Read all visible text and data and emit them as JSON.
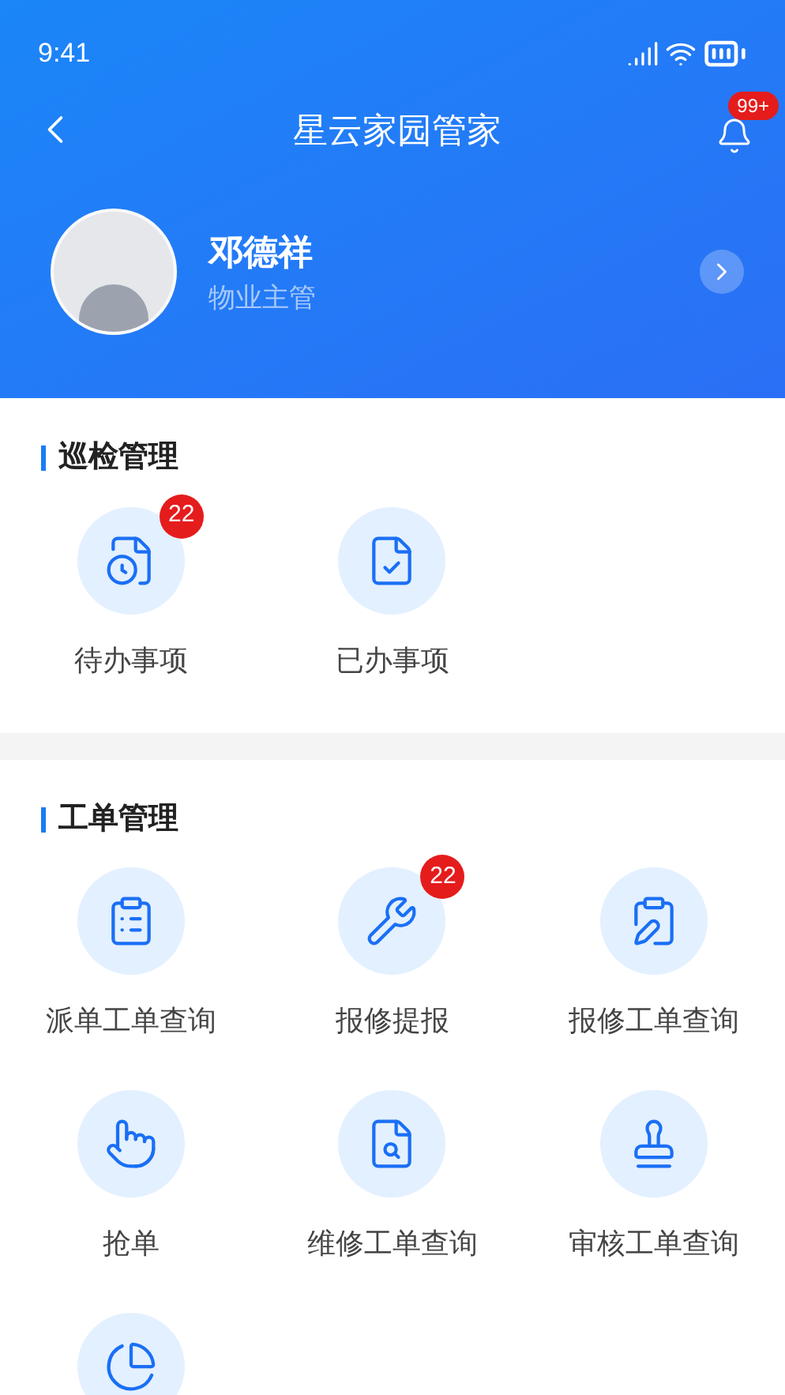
{
  "status_bar": {
    "time": "9:41"
  },
  "nav": {
    "title": "星云家园管家",
    "notification_badge": "99+"
  },
  "profile": {
    "name": "邓德祥",
    "role": "物业主管"
  },
  "sections": [
    {
      "title": "巡检管理",
      "items": [
        {
          "label": "待办事项",
          "badge": "22",
          "cut_off": false
        },
        {
          "label": "已办事项",
          "cut_off": false
        }
      ]
    },
    {
      "title": "工单管理",
      "items": [
        {
          "label": "派单工单查询",
          "cut_off": false
        },
        {
          "label": "报修提报",
          "badge": "22",
          "cut_off": false
        },
        {
          "label": "报修工单查询",
          "cut_off": false
        },
        {
          "label": "抢单",
          "cut_off": false
        },
        {
          "label": "维修工单查询",
          "cut_off": false
        },
        {
          "label": "审核工单查询",
          "cut_off": false
        },
        {
          "cut_off": true
        }
      ]
    }
  ]
}
